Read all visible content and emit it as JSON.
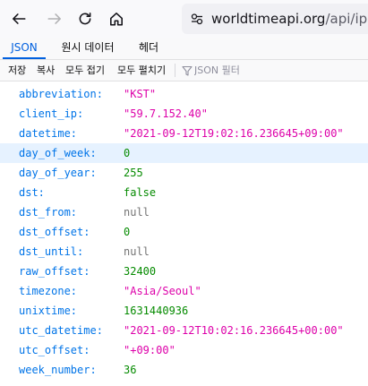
{
  "browser": {
    "url_host": "worldtimeapi.org",
    "url_path": "/api/ip",
    "icons": [
      "back-arrow-icon",
      "forward-arrow-icon",
      "reload-icon",
      "home-icon",
      "site-info-icon"
    ]
  },
  "tabs": [
    {
      "label": "JSON",
      "active": true
    },
    {
      "label": "원시 데이터",
      "active": false
    },
    {
      "label": "헤더",
      "active": false
    }
  ],
  "toolbar": {
    "save": "저장",
    "copy": "복사",
    "collapse_all": "모두 접기",
    "expand_all": "모두 펼치기",
    "filter_placeholder": "JSON 필터"
  },
  "colors": {
    "key": "#0074e8",
    "string": "#dd00a9",
    "number": "#058b00",
    "null": "#737373",
    "selected_row": "#e6f2ff",
    "active_tab": "#0060df"
  },
  "rows": [
    {
      "key": "abbreviation:",
      "value": "\"KST\"",
      "type": "string"
    },
    {
      "key": "client_ip:",
      "value": "\"59.7.152.40\"",
      "type": "string"
    },
    {
      "key": "datetime:",
      "value": "\"2021-09-12T19:02:16.236645+09:00\"",
      "type": "string"
    },
    {
      "key": "day_of_week:",
      "value": "0",
      "type": "number",
      "selected": true
    },
    {
      "key": "day_of_year:",
      "value": "255",
      "type": "number"
    },
    {
      "key": "dst:",
      "value": "false",
      "type": "bool"
    },
    {
      "key": "dst_from:",
      "value": "null",
      "type": "null"
    },
    {
      "key": "dst_offset:",
      "value": "0",
      "type": "number"
    },
    {
      "key": "dst_until:",
      "value": "null",
      "type": "null"
    },
    {
      "key": "raw_offset:",
      "value": "32400",
      "type": "number"
    },
    {
      "key": "timezone:",
      "value": "\"Asia/Seoul\"",
      "type": "string"
    },
    {
      "key": "unixtime:",
      "value": "1631440936",
      "type": "number"
    },
    {
      "key": "utc_datetime:",
      "value": "\"2021-09-12T10:02:16.236645+00:00\"",
      "type": "string"
    },
    {
      "key": "utc_offset:",
      "value": "\"+09:00\"",
      "type": "string"
    },
    {
      "key": "week_number:",
      "value": "36",
      "type": "number"
    }
  ]
}
